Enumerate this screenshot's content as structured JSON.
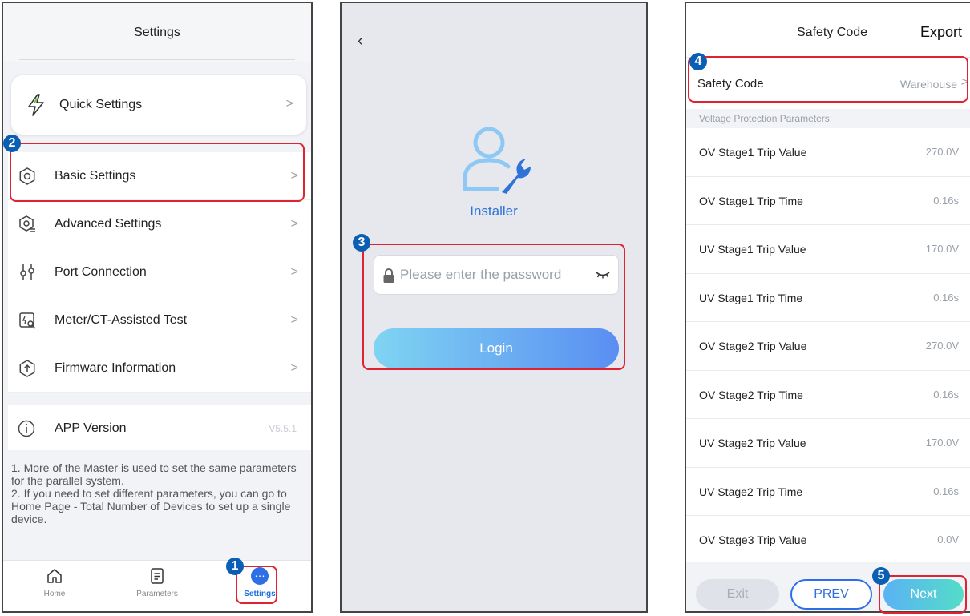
{
  "panel1": {
    "header_title": "Settings",
    "quick_settings": "Quick Settings",
    "menu": [
      {
        "label": "Basic Settings",
        "icon": "gear-icon"
      },
      {
        "label": "Advanced Settings",
        "icon": "advanced-settings-icon"
      },
      {
        "label": "Port Connection",
        "icon": "port-connection-icon"
      },
      {
        "label": "Meter/CT-Assisted Test",
        "icon": "meter-test-icon"
      },
      {
        "label": "Firmware Information",
        "icon": "firmware-icon"
      }
    ],
    "app_version_label": "APP Version",
    "app_version_value": "V5.5.1",
    "note": "1. More of the Master is used to set the same parameters for the parallel system.\n2. If you need to set different parameters, you can go to Home Page - Total Number of Devices to set up a single device.",
    "tabs": {
      "home": "Home",
      "parameters": "Parameters",
      "settings": "Settings"
    }
  },
  "panel2": {
    "role": "Installer",
    "password_placeholder": "Please enter the password",
    "login": "Login"
  },
  "panel3": {
    "title": "Safety Code",
    "export": "Export",
    "safety_code_label": "Safety Code",
    "safety_code_value": "Warehouse",
    "section": "Voltage Protection Parameters:",
    "params": [
      {
        "label": "OV Stage1 Trip Value",
        "value": "270.0V"
      },
      {
        "label": "OV Stage1 Trip Time",
        "value": "0.16s"
      },
      {
        "label": "UV Stage1 Trip Value",
        "value": "170.0V"
      },
      {
        "label": "UV Stage1 Trip Time",
        "value": "0.16s"
      },
      {
        "label": "OV Stage2 Trip Value",
        "value": "270.0V"
      },
      {
        "label": "OV Stage2 Trip Time",
        "value": "0.16s"
      },
      {
        "label": "UV Stage2 Trip Value",
        "value": "170.0V"
      },
      {
        "label": "UV Stage2 Trip Time",
        "value": "0.16s"
      },
      {
        "label": "OV Stage3 Trip Value",
        "value": "0.0V"
      }
    ],
    "exit": "Exit",
    "prev": "PREV",
    "next": "Next"
  },
  "annotations": {
    "step1": "1",
    "step2": "2",
    "step3": "3",
    "step4": "4",
    "step5": "5",
    "highlight_color": "#e02233",
    "badge_color": "#0a5fb4"
  },
  "colors": {
    "accent_blue": "#2f6fe6",
    "installer_blue": "#2f73d9"
  }
}
